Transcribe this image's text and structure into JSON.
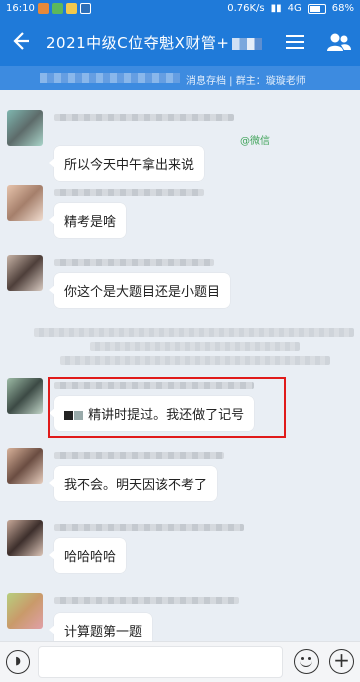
{
  "status_bar": {
    "time": "16:10",
    "speed": "0.76K/s",
    "network": "4G",
    "battery": "68%"
  },
  "header": {
    "title": "2021中级C位夺魁X财管+",
    "back_icon": "back-arrow-icon",
    "menu_icon": "hamburger-menu-icon",
    "members_icon": "group-members-icon"
  },
  "subheader": {
    "text": "消息存档 | 群主：璇璇老师"
  },
  "messages": [
    {
      "text": "所以今天中午拿出来说",
      "tag": "@微信"
    },
    {
      "text": "精考是啥"
    },
    {
      "text": "你这个是大题目还是小题目"
    },
    {
      "text": "精讲时提过。我还做了记号"
    },
    {
      "text": "我不会。明天因该不考了"
    },
    {
      "text": "哈哈哈哈"
    },
    {
      "text": "计算题第一题"
    }
  ],
  "input_bar": {
    "voice_icon": "voice-icon",
    "emoji_icon": "emoji-icon",
    "plus_icon": "plus-icon",
    "placeholder": ""
  },
  "colors": {
    "primary": "#1f7ad9",
    "highlight_border": "#e01a1a"
  }
}
